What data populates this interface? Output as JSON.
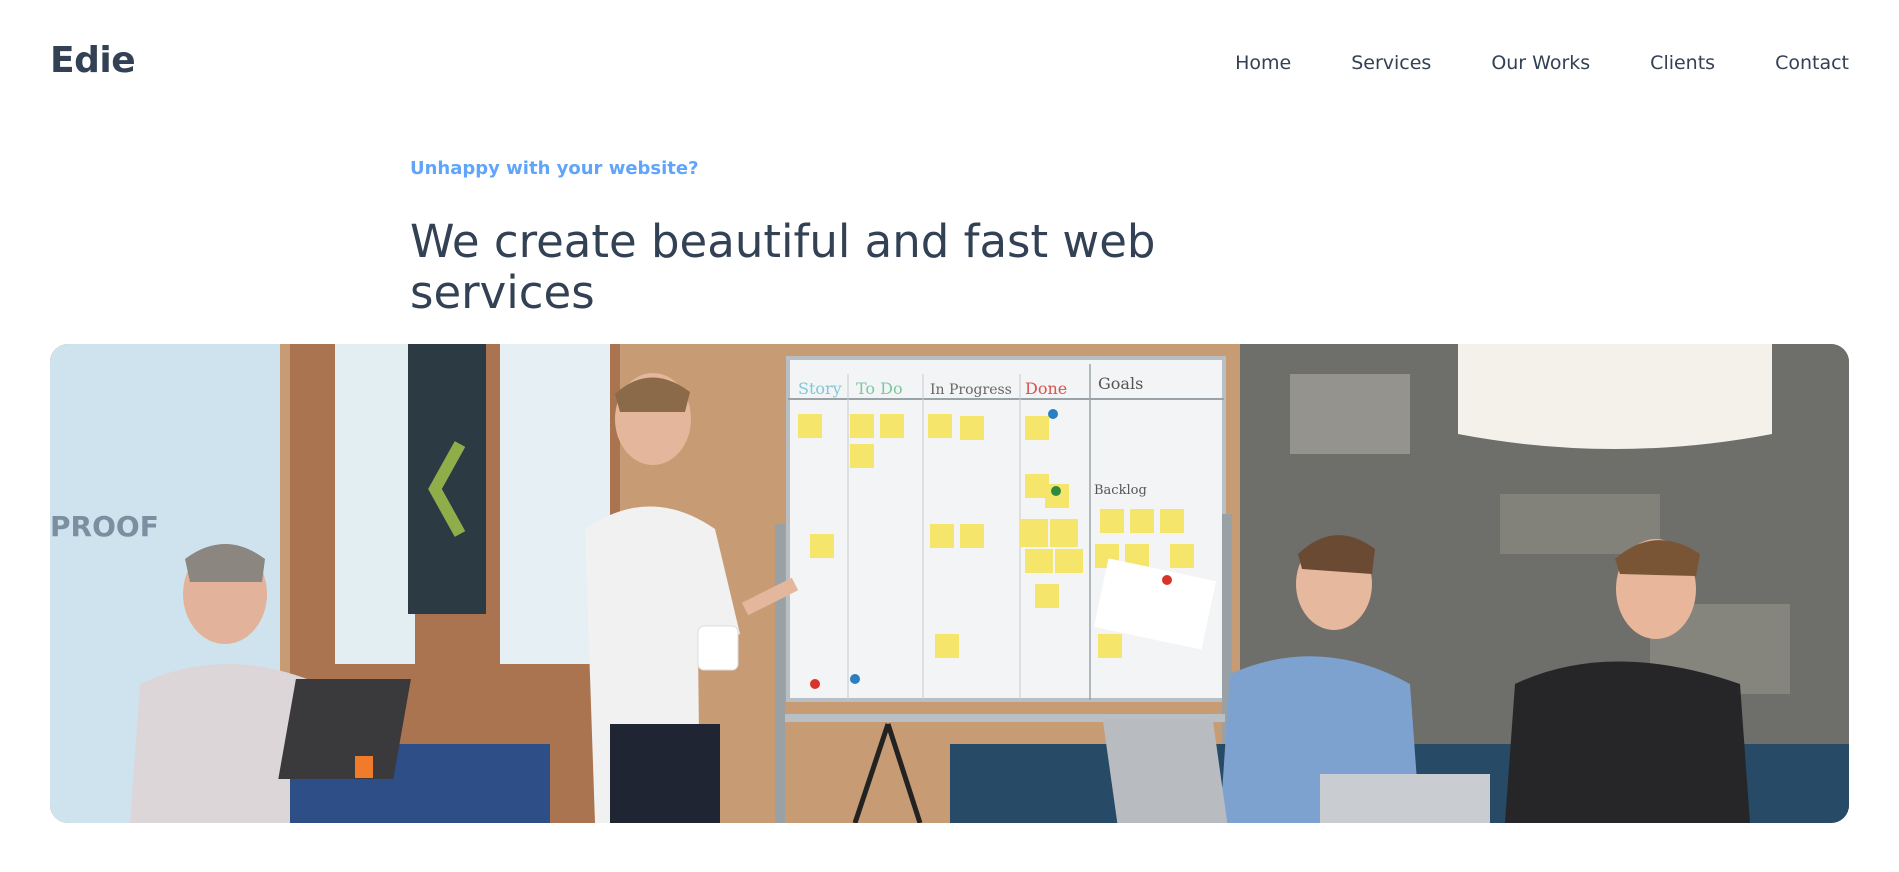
{
  "brand": {
    "logo": "Edie"
  },
  "nav": {
    "items": [
      {
        "label": "Home"
      },
      {
        "label": "Services"
      },
      {
        "label": "Our Works"
      },
      {
        "label": "Clients"
      },
      {
        "label": "Contact"
      }
    ]
  },
  "hero": {
    "kicker": "Unhappy with your website?",
    "headline": "We create beautiful and fast web services",
    "image": {
      "whiteboard_columns": [
        "Story",
        "To Do",
        "In Progress",
        "Done",
        "Goals"
      ],
      "whiteboard_section": "Backlog",
      "window_sign": "PROOF"
    }
  },
  "colors": {
    "text": "#334155",
    "accent": "#60a5fa",
    "background": "#ffffff"
  }
}
